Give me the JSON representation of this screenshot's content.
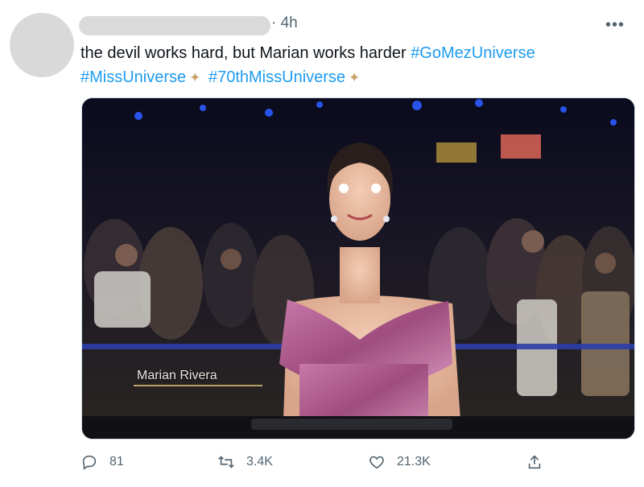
{
  "tweet": {
    "time": "4h",
    "more_label": "•••",
    "text_prefix": "the devil works hard, but Marian works harder",
    "hashtags": [
      "#GoMezUniverse",
      "#MissUniverse",
      "#70thMissUniverse"
    ],
    "sparkle": "✦",
    "media_caption": "Marian Rivera"
  },
  "actions": {
    "replies": "81",
    "retweets": "3.4K",
    "likes": "21.3K"
  },
  "icons": {
    "reply": "reply-icon",
    "retweet": "retweet-icon",
    "like": "heart-icon",
    "share": "share-icon",
    "more": "more-icon"
  },
  "colors": {
    "hashtag": "#1d9bf0",
    "secondary_text": "#536471"
  }
}
